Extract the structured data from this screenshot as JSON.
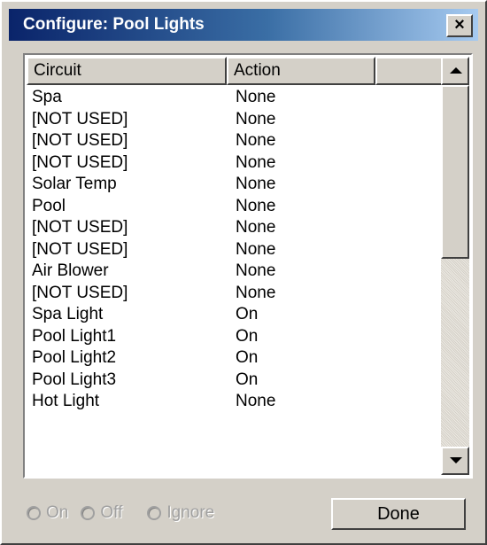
{
  "window": {
    "title": "Configure: Pool Lights",
    "close_label": "×"
  },
  "list": {
    "columns": [
      "Circuit",
      "Action",
      ""
    ],
    "rows": [
      {
        "circuit": "Spa",
        "action": "None"
      },
      {
        "circuit": "[NOT USED]",
        "action": "None"
      },
      {
        "circuit": "[NOT USED]",
        "action": "None"
      },
      {
        "circuit": "[NOT USED]",
        "action": "None"
      },
      {
        "circuit": "Solar Temp",
        "action": "None"
      },
      {
        "circuit": "Pool",
        "action": "None"
      },
      {
        "circuit": "[NOT USED]",
        "action": "None"
      },
      {
        "circuit": "[NOT USED]",
        "action": "None"
      },
      {
        "circuit": "Air Blower",
        "action": "None"
      },
      {
        "circuit": "[NOT USED]",
        "action": "None"
      },
      {
        "circuit": "Spa Light",
        "action": "On"
      },
      {
        "circuit": "Pool Light1",
        "action": "On"
      },
      {
        "circuit": "Pool Light2",
        "action": "On"
      },
      {
        "circuit": "Pool Light3",
        "action": "On"
      },
      {
        "circuit": "Hot Light",
        "action": "None"
      }
    ]
  },
  "options": {
    "on_label": "On",
    "off_label": "Off",
    "ignore_label": "Ignore"
  },
  "buttons": {
    "done_label": "Done"
  },
  "colors": {
    "title_bar_start": "#0a246a",
    "title_bar_end": "#a6caf0",
    "face": "#d4d0c8"
  }
}
